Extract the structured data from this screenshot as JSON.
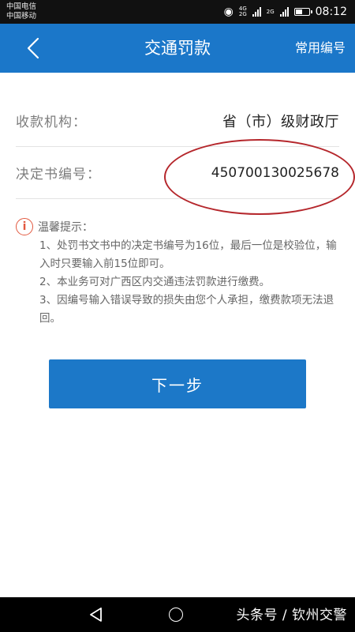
{
  "status_bar": {
    "carrier_1": "中国电信",
    "carrier_2": "中国移动",
    "net_1": "4G",
    "net_2": "2G",
    "net_3": "2G",
    "battery_level": 0.55,
    "time": "08:12"
  },
  "header": {
    "title": "交通罚款",
    "right_action": "常用编号"
  },
  "form": {
    "agency_label": "收款机构：",
    "agency_value": "省（市）级财政厅",
    "number_label": "决定书编号：",
    "number_value": "450700130025678"
  },
  "tips": {
    "title": "温馨提示：",
    "items": [
      "1、处罚书文书中的决定书编号为16位，最后一位是校验位，输入时只要输入前15位即可。",
      "2、本业务可对广西区内交通违法罚款进行缴费。",
      "3、因编号输入错误导致的损失由您个人承担，缴费款项无法退回。"
    ]
  },
  "next_button": "下一步",
  "watermark": "头条号 / 钦州交警",
  "colors": {
    "primary": "#1b77c9",
    "annotation": "#b5272c",
    "warning": "#e2583f"
  }
}
